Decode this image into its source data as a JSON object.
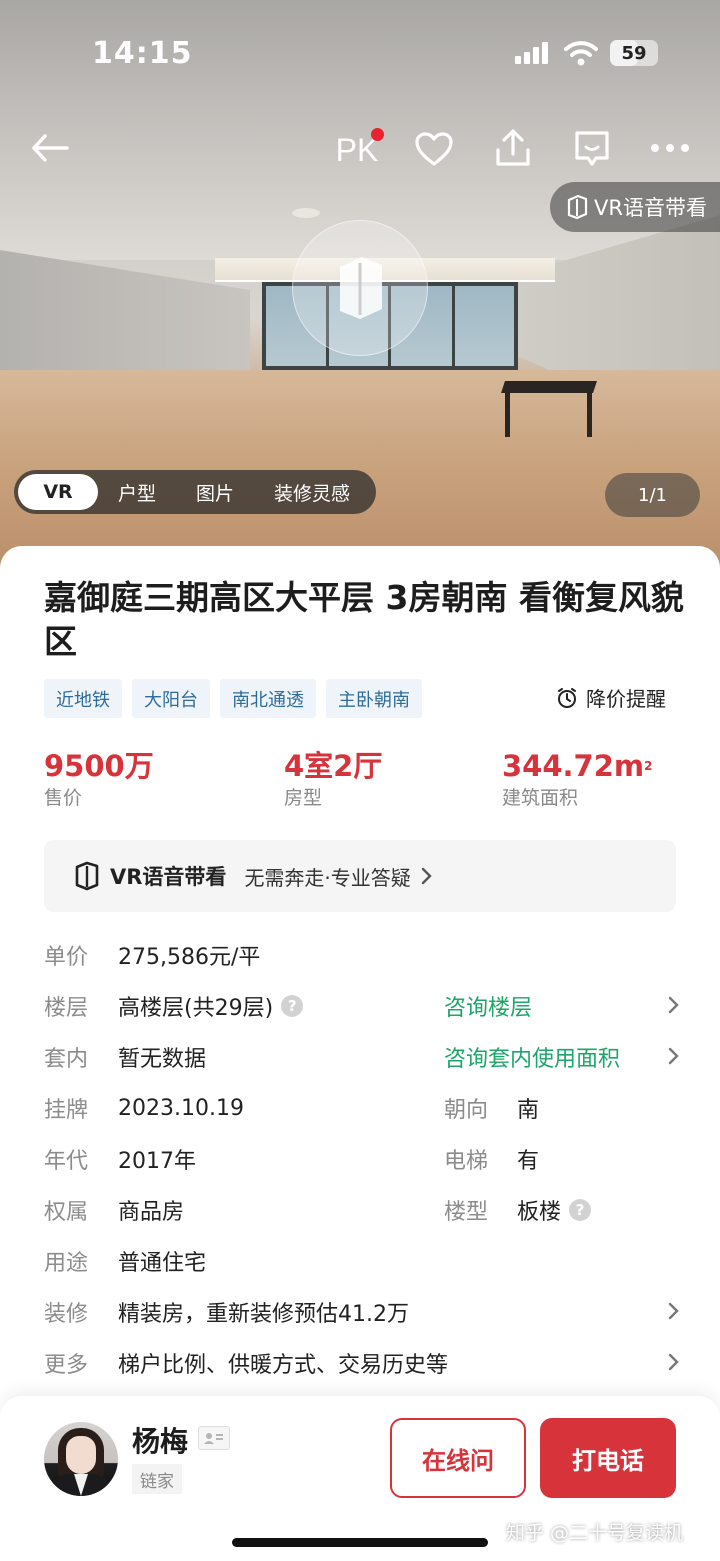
{
  "status_bar": {
    "time": "14:15",
    "battery": "59",
    "battery_level": 0.59
  },
  "nav": {
    "pk_label": "PK"
  },
  "vr_voice_chip": "VR语音带看",
  "media_tabs": [
    {
      "label": "VR",
      "active": true
    },
    {
      "label": "户型",
      "active": false
    },
    {
      "label": "图片",
      "active": false
    },
    {
      "label": "装修灵感",
      "active": false
    }
  ],
  "media_counter": "1/1",
  "listing": {
    "title": "嘉御庭三期高区大平层 3房朝南 看衡复风貌区",
    "tags": [
      "近地铁",
      "大阳台",
      "南北通透",
      "主卧朝南"
    ],
    "price_alert": "降价提醒",
    "kpis": {
      "price": {
        "value": "9500万",
        "label": "售价"
      },
      "layout": {
        "value": "4室2厅",
        "label": "房型"
      },
      "area": {
        "value": "344.72m",
        "sup": "2",
        "label": "建筑面积"
      }
    },
    "vr_banner": {
      "title": "VR语音带看",
      "subtitle": "无需奔走·专业答疑"
    },
    "details": {
      "unit_price": {
        "key": "单价",
        "value": "275,586元/平"
      },
      "floor": {
        "key": "楼层",
        "value": "高楼层(共29层)",
        "link": "咨询楼层"
      },
      "inner": {
        "key": "套内",
        "value": "暂无数据",
        "link": "咨询套内使用面积"
      },
      "listed": {
        "key": "挂牌",
        "value": "2023.10.19",
        "key2": "朝向",
        "value2": "南"
      },
      "year": {
        "key": "年代",
        "value": "2017年",
        "key2": "电梯",
        "value2": "有"
      },
      "ownership": {
        "key": "权属",
        "value": "商品房",
        "key2": "楼型",
        "value2": "板楼"
      },
      "usage": {
        "key": "用途",
        "value": "普通住宅"
      },
      "decoration": {
        "key": "装修",
        "value": "精装房，重新装修预估41.2万"
      },
      "more": {
        "key": "更多",
        "value": "梯户比例、供暖方式、交易历史等"
      }
    }
  },
  "agent": {
    "name": "杨梅",
    "company": "链家"
  },
  "actions": {
    "online": "在线问",
    "call": "打电话"
  },
  "watermark": "知乎 @二十号复读机",
  "colors": {
    "accent_red": "#d7333b",
    "link_green": "#1ea569",
    "tag_blue": "#2f6c9b"
  }
}
